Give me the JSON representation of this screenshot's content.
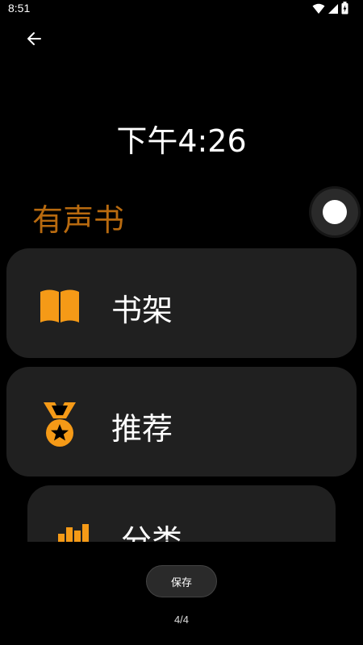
{
  "status_bar": {
    "time": "8:51",
    "icons": [
      "wifi-icon",
      "signal-icon",
      "battery-icon"
    ]
  },
  "header": {
    "back_icon": "arrow-left-icon"
  },
  "watch": {
    "time": "下午4:26",
    "title": "有声书"
  },
  "colors": {
    "accent": "#f59a17",
    "title": "#b86a0f",
    "card_bg": "#202020",
    "background": "#000000"
  },
  "menu": {
    "items": [
      {
        "label": "书架",
        "icon": "open-book-icon"
      },
      {
        "label": "推荐",
        "icon": "medal-star-icon"
      },
      {
        "label": "分类",
        "icon": "books-category-icon"
      }
    ]
  },
  "footer": {
    "save_label": "保存",
    "page_indicator": "4/4"
  }
}
